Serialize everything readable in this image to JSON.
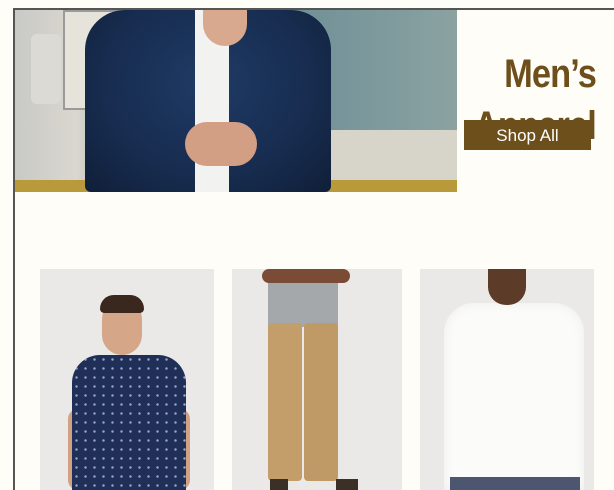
{
  "hero": {
    "title": "Men’s Apparel",
    "cta_label": "Shop All",
    "image_description": "model-denim-jacket"
  },
  "products": [
    {
      "image": "model-navy-polka-dot-shirt"
    },
    {
      "image": "model-khaki-chinos"
    },
    {
      "image": "model-white-tee"
    }
  ],
  "colors": {
    "background": "#fffdf8",
    "accent": "#6d4f1c",
    "button_text": "#ffffff"
  }
}
